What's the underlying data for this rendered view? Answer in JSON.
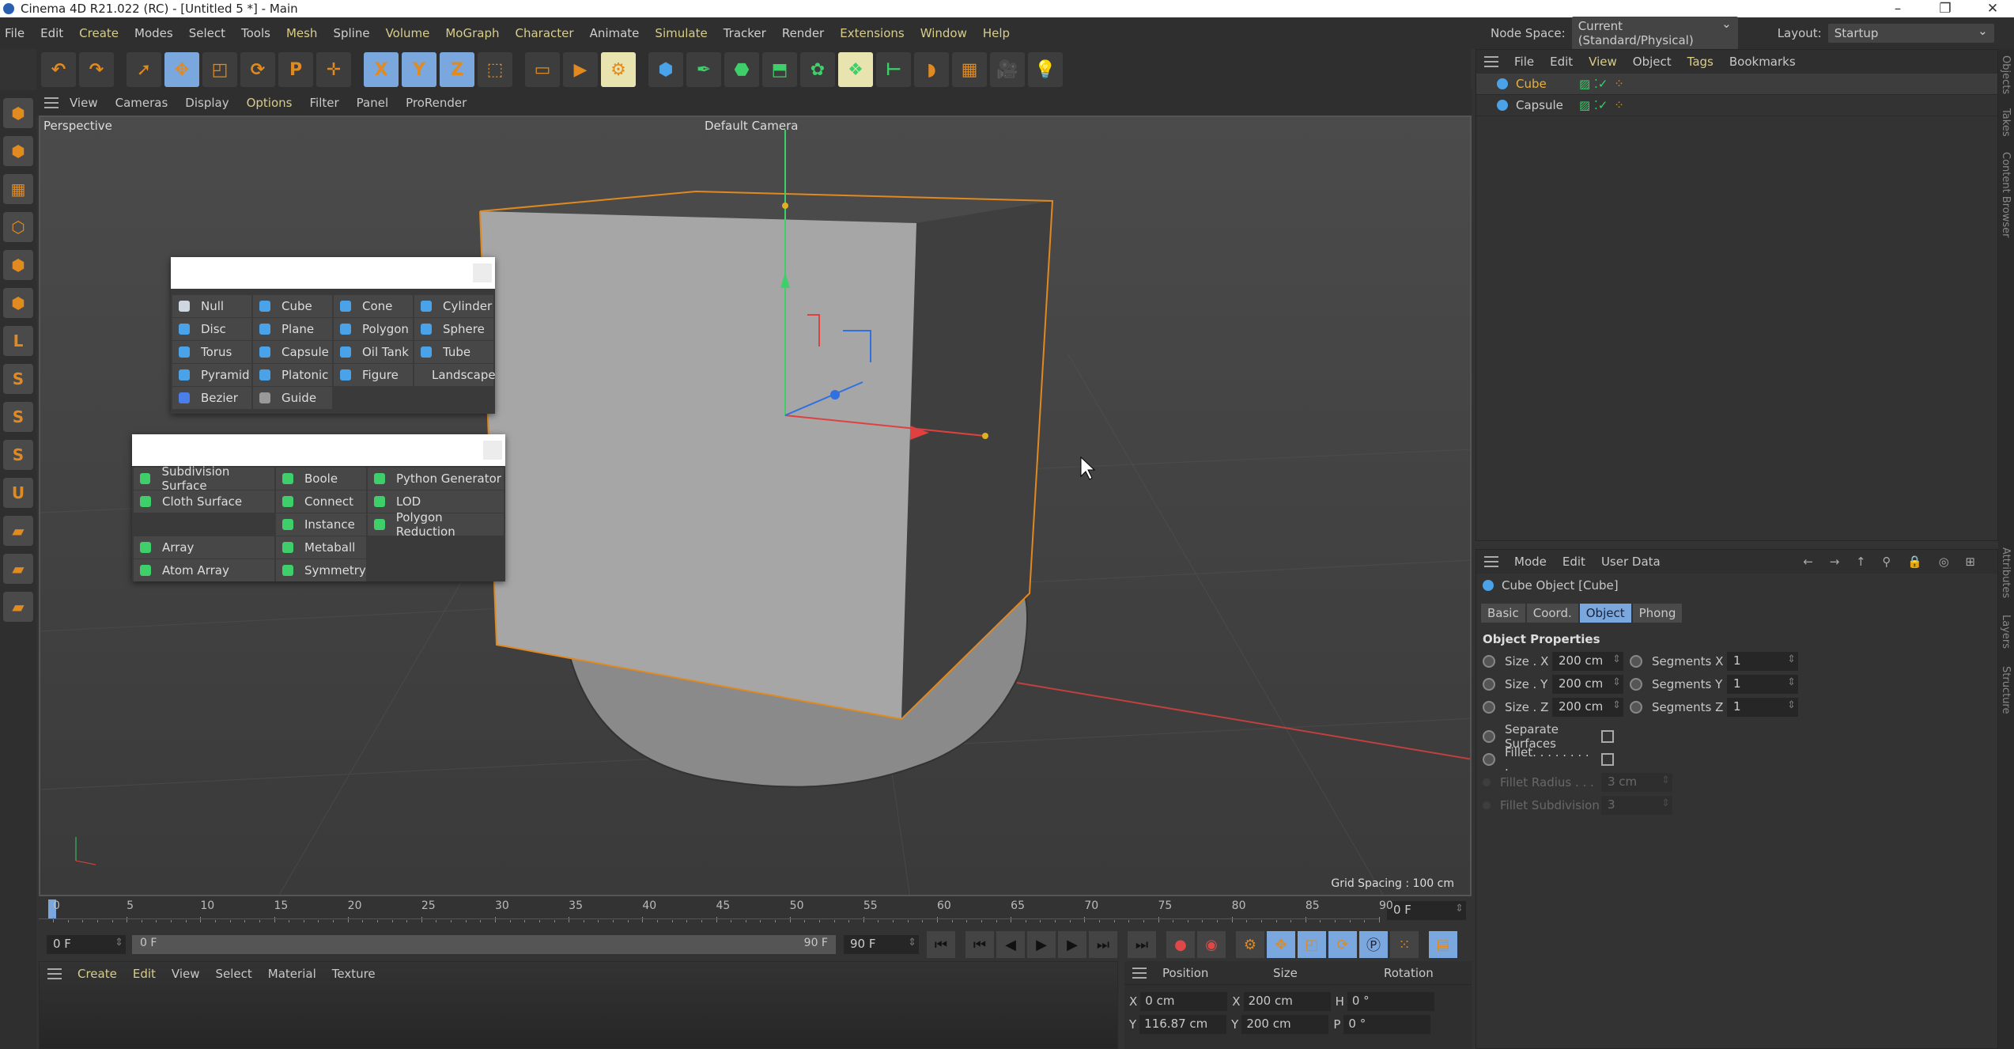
{
  "window": {
    "title": "Cinema 4D R21.022 (RC) - [Untitled 5 *] - Main",
    "controls": [
      "–",
      "❐",
      "✕"
    ]
  },
  "menubar": {
    "items": [
      "File",
      "Edit",
      "Create",
      "Modes",
      "Select",
      "Tools",
      "Mesh",
      "Spline",
      "Volume",
      "MoGraph",
      "Character",
      "Animate",
      "Simulate",
      "Tracker",
      "Render",
      "Extensions",
      "Window",
      "Help"
    ]
  },
  "nodespace": {
    "label": "Node Space:",
    "value": "Current (Standard/Physical)",
    "layout_label": "Layout:",
    "layout_value": "Startup"
  },
  "toolbar": {
    "icons": [
      {
        "name": "undo",
        "glyph": "↶"
      },
      {
        "name": "redo",
        "glyph": "↷"
      },
      {
        "name": "live-selection",
        "glyph": "➚"
      },
      {
        "name": "move",
        "glyph": "✥",
        "sel": true
      },
      {
        "name": "scale",
        "glyph": "◰"
      },
      {
        "name": "rotate",
        "glyph": "⟳"
      },
      {
        "name": "psr",
        "glyph": "P"
      },
      {
        "name": "transform",
        "glyph": "✛"
      },
      {
        "name": "x-axis",
        "glyph": "X",
        "sel": true
      },
      {
        "name": "y-axis",
        "glyph": "Y",
        "sel": true
      },
      {
        "name": "z-axis",
        "glyph": "Z",
        "sel": true
      },
      {
        "name": "coordinate-system",
        "glyph": "⬚"
      },
      {
        "name": "render-view",
        "glyph": "▭"
      },
      {
        "name": "render-picture-viewer",
        "glyph": "▶"
      },
      {
        "name": "render-settings",
        "glyph": "⚙",
        "hl": true
      },
      {
        "name": "cube-object",
        "glyph": "⬢"
      },
      {
        "name": "pen-spline",
        "glyph": "✒"
      },
      {
        "name": "subdivision-surface",
        "glyph": "⬣"
      },
      {
        "name": "extrude",
        "glyph": "⬒"
      },
      {
        "name": "cloner",
        "glyph": "✿"
      },
      {
        "name": "generators",
        "glyph": "❖",
        "hl": true
      },
      {
        "name": "deformer",
        "glyph": "⊢"
      },
      {
        "name": "field",
        "glyph": "◗"
      },
      {
        "name": "floor",
        "glyph": "▦"
      },
      {
        "name": "camera",
        "glyph": "🎥"
      },
      {
        "name": "light",
        "glyph": "💡"
      }
    ]
  },
  "left_tools": [
    "make-editable",
    "model-mode",
    "texture-mode",
    "points-mode",
    "edges-mode",
    "polygons-mode",
    "axis-mode",
    "snap",
    "workplane",
    "locked-workplane",
    "magnet",
    "solo",
    "solo-hierarchy",
    "planar"
  ],
  "viewport": {
    "menu": [
      "View",
      "Cameras",
      "Display",
      "Options",
      "Filter",
      "Panel",
      "ProRender"
    ],
    "view_name": "Perspective",
    "camera": "Default Camera",
    "grid_spacing": "Grid Spacing : 100 cm",
    "colors": {
      "cube_face": "#a6a6a6",
      "cube_side": "#3f3f3f",
      "selection": "#e0891f"
    }
  },
  "primitives_popup": {
    "search_value": "",
    "items": [
      {
        "label": "Null",
        "color": "#cfd8e0"
      },
      {
        "label": "Cube",
        "color": "#4aa3e8"
      },
      {
        "label": "Cone",
        "color": "#4aa3e8"
      },
      {
        "label": "Cylinder",
        "color": "#4aa3e8"
      },
      {
        "label": "Disc",
        "color": "#4aa3e8"
      },
      {
        "label": "Plane",
        "color": "#4aa3e8"
      },
      {
        "label": "Polygon",
        "color": "#4aa3e8"
      },
      {
        "label": "Sphere",
        "color": "#4aa3e8"
      },
      {
        "label": "Torus",
        "color": "#4aa3e8"
      },
      {
        "label": "Capsule",
        "color": "#4aa3e8"
      },
      {
        "label": "Oil Tank",
        "color": "#4aa3e8"
      },
      {
        "label": "Tube",
        "color": "#4aa3e8"
      },
      {
        "label": "Pyramid",
        "color": "#4aa3e8"
      },
      {
        "label": "Platonic",
        "color": "#4aa3e8"
      },
      {
        "label": "Figure",
        "color": "#4aa3e8"
      },
      {
        "label": "Landscape",
        "color": "#4aa3e8"
      },
      {
        "label": "Bezier",
        "color": "#4a7ee8"
      },
      {
        "label": "Guide",
        "color": "#999999"
      }
    ]
  },
  "generators_popup": {
    "search_value": "",
    "columns": [
      [
        {
          "label": "Subdivision Surface"
        },
        {
          "label": "Cloth Surface"
        },
        null,
        {
          "label": "Array"
        },
        {
          "label": "Atom Array"
        }
      ],
      [
        {
          "label": "Boole"
        },
        {
          "label": "Connect"
        },
        {
          "label": "Instance"
        },
        {
          "label": "Metaball"
        },
        {
          "label": "Symmetry"
        }
      ],
      [
        {
          "label": "Python Generator"
        },
        {
          "label": "LOD"
        },
        {
          "label": "Polygon Reduction"
        }
      ]
    ],
    "color": "#3ecf6a"
  },
  "object_manager": {
    "menu": [
      "File",
      "Edit",
      "View",
      "Object",
      "Tags",
      "Bookmarks"
    ],
    "objects": [
      {
        "name": "Cube",
        "selected": true
      },
      {
        "name": "Capsule",
        "selected": false
      }
    ]
  },
  "side_tabs": [
    "Objects",
    "Takes",
    "Content Browser",
    "Attributes",
    "Layers",
    "Structure"
  ],
  "attributes": {
    "menu": [
      "Mode",
      "Edit",
      "User Data"
    ],
    "title": "Cube Object [Cube]",
    "tabs": [
      {
        "label": "Basic"
      },
      {
        "label": "Coord."
      },
      {
        "label": "Object",
        "active": true
      },
      {
        "label": "Phong"
      }
    ],
    "section": "Object Properties",
    "size": [
      {
        "label": "Size . X",
        "value": "200 cm"
      },
      {
        "label": "Size . Y",
        "value": "200 cm"
      },
      {
        "label": "Size . Z",
        "value": "200 cm"
      }
    ],
    "segments": [
      {
        "label": "Segments X",
        "value": "1"
      },
      {
        "label": "Segments Y",
        "value": "1"
      },
      {
        "label": "Segments Z",
        "value": "1"
      }
    ],
    "separate_surfaces": {
      "label": "Separate Surfaces",
      "checked": false
    },
    "fillet": {
      "label": "Fillet. . . . . . . . .",
      "checked": false
    },
    "fillet_radius": {
      "label": "Fillet Radius . . .",
      "value": "3 cm"
    },
    "fillet_subdivision": {
      "label": "Fillet Subdivision",
      "value": "3"
    }
  },
  "timeline": {
    "start": 0,
    "end": 90,
    "step": 5,
    "current": 0,
    "current_label": "0 F"
  },
  "playback": {
    "min_field": "0 F",
    "range_start": "0 F",
    "range_end": "90 F",
    "max_field": "90 F"
  },
  "material_manager": {
    "menu": [
      "Create",
      "Edit",
      "View",
      "Select",
      "Material",
      "Texture"
    ]
  },
  "coordinates": {
    "headers": [
      "Position",
      "Size",
      "Rotation"
    ],
    "rows": [
      {
        "pl": "X",
        "pv": "0 cm",
        "sl": "X",
        "sv": "200 cm",
        "rl": "H",
        "rv": "0 °"
      },
      {
        "pl": "Y",
        "pv": "116.87 cm",
        "sl": "Y",
        "sv": "200 cm",
        "rl": "P",
        "rv": "0 °"
      }
    ]
  }
}
